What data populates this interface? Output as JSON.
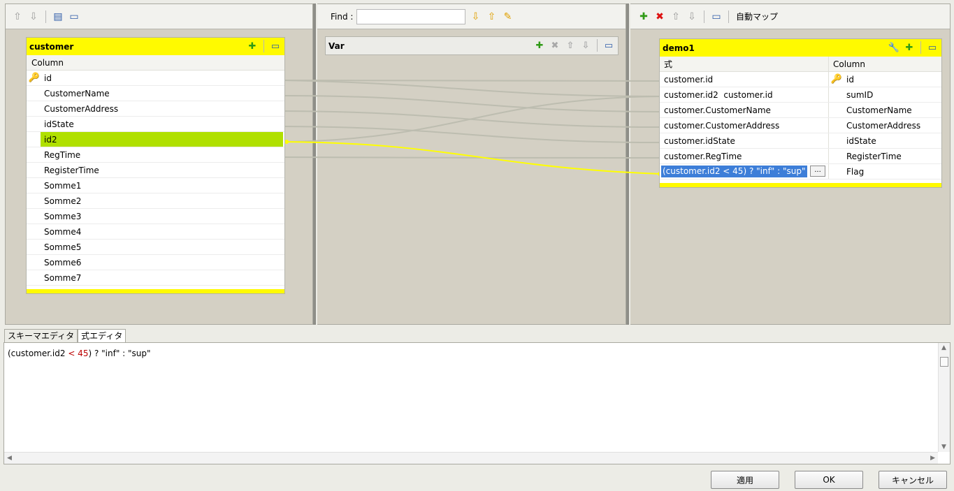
{
  "left_toolbar": {
    "icons": [
      "arrow-up-icon",
      "arrow-down-icon",
      "table-icon",
      "minimize-icon"
    ]
  },
  "center_toolbar": {
    "find_label": "Find :",
    "find_value": "",
    "icons": [
      "arrow-down-icon",
      "arrow-up-icon",
      "edit-icon"
    ]
  },
  "right_toolbar": {
    "auto_map_label": "自動マップ",
    "icons": [
      "add-icon",
      "delete-icon",
      "arrow-up-icon",
      "arrow-down-icon",
      "minimize-icon"
    ]
  },
  "input_table": {
    "title": "customer",
    "column_header": "Column",
    "rows": [
      "id",
      "CustomerName",
      "CustomerAddress",
      "idState",
      "id2",
      "RegTime",
      "RegisterTime",
      "Somme1",
      "Somme2",
      "Somme3",
      "Somme4",
      "Somme5",
      "Somme6",
      "Somme7"
    ],
    "selected_row": "id2",
    "key_row": "id"
  },
  "var_table": {
    "title": "Var"
  },
  "output_table": {
    "title": "demo1",
    "expr_header": "式",
    "column_header": "Column",
    "rows": [
      {
        "expr": "customer.id",
        "column": "id",
        "key": true
      },
      {
        "expr": "customer.id2  customer.id",
        "column": "sumID",
        "key": false
      },
      {
        "expr": "customer.CustomerName",
        "column": "CustomerName",
        "key": false
      },
      {
        "expr": "customer.CustomerAddress",
        "column": "CustomerAddress",
        "key": false
      },
      {
        "expr": "customer.idState",
        "column": "idState",
        "key": false
      },
      {
        "expr": "customer.RegTime",
        "column": "RegisterTime",
        "key": false
      },
      {
        "expr": "(customer.id2 < 45) ? \"inf\" : \"sup\"",
        "column": "Flag",
        "key": false,
        "editing": true
      }
    ],
    "dots_label": "..."
  },
  "tabs": {
    "schema_editor": "スキーマエディタ",
    "expression_editor": "式エディタ"
  },
  "expression_editor": {
    "text_prefix": "(customer.id2 ",
    "text_op": "< 45",
    "text_suffix": ") ? \"inf\" : \"sup\""
  },
  "buttons": {
    "apply": "適用",
    "ok": "OK",
    "cancel": "キャンセル"
  },
  "colors": {
    "table_header": "#fffa00",
    "selected_row": "#b0e000",
    "link_active": "#ffff00",
    "link_inactive": "#c0c0b4",
    "expr_selection": "#3d7ed8"
  }
}
